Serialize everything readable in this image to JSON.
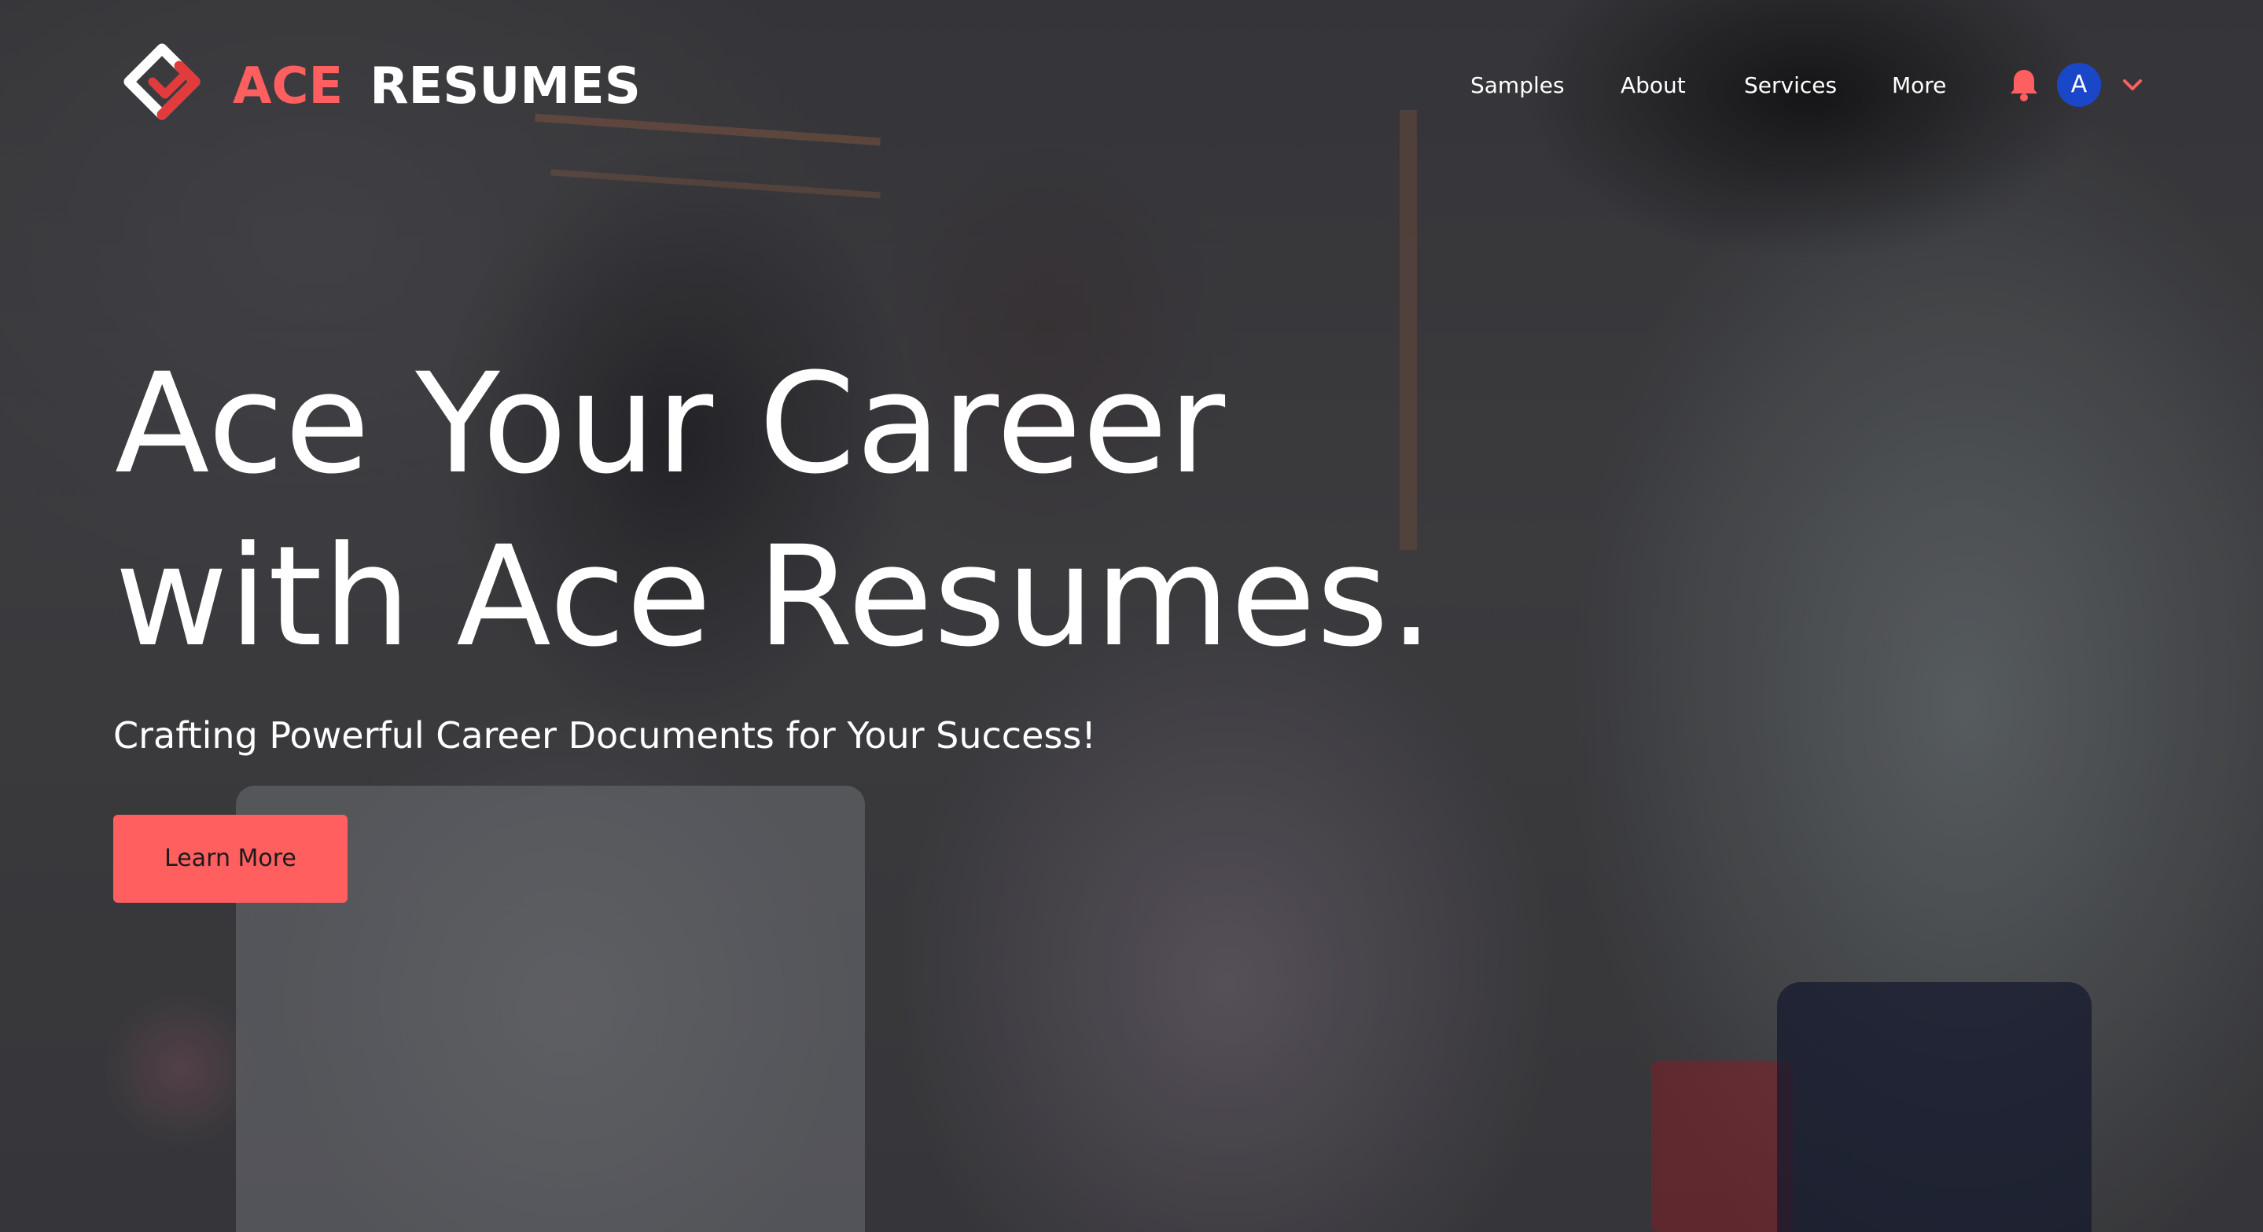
{
  "brand": {
    "name_part1": "ACE",
    "name_part2": "RESUMES",
    "logo_icon": "ace-resumes-logo-icon",
    "accent_color": "#ff5f5f"
  },
  "nav": {
    "links": [
      {
        "label": "Samples"
      },
      {
        "label": "About"
      },
      {
        "label": "Services"
      },
      {
        "label": "More"
      }
    ],
    "notification_icon": "bell-icon",
    "notification_color": "#ff5f5f",
    "avatar": {
      "initial": "A",
      "color": "#1a47c8"
    },
    "account_menu_icon": "chevron-down-icon"
  },
  "hero": {
    "headline_line1": "Ace Your Career",
    "headline_line2": "with Ace Resumes.",
    "subtitle": "Crafting Powerful Career Documents for Your Success!",
    "cta_label": "Learn More",
    "cta_color": "#ff5f5f",
    "background": "office-team-photo"
  }
}
